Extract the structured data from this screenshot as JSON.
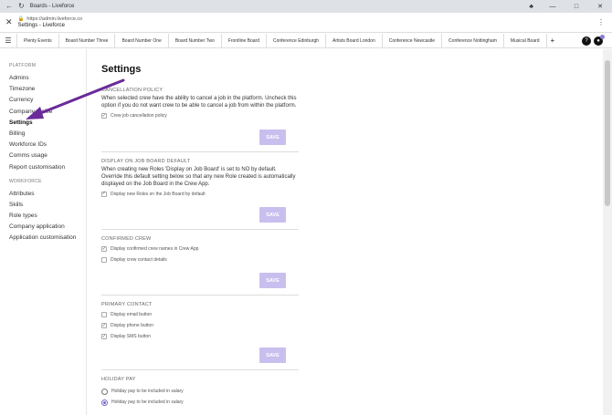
{
  "window": {
    "tab_title": "Boards - Liveforce",
    "url": "https://admin.liveforce.co",
    "page_title": "Settings - Liveforce"
  },
  "tabs": [
    "Plenty Events",
    "Board Number Three",
    "Board Number One",
    "Board Number Two",
    "Frontline Board",
    "Conference Edinburgh",
    "Artists Board London",
    "Conference Newcastle",
    "Conference Nottingham",
    "Musical Board"
  ],
  "sidebar": {
    "platform_heading": "PLATFORM",
    "platform_items": [
      "Admins",
      "Timezone",
      "Currency",
      "Company profile",
      "Settings",
      "Billing",
      "Workforce IDs",
      "Comms usage",
      "Report customisation"
    ],
    "workforce_heading": "WORKFORCE",
    "workforce_items": [
      "Attributes",
      "Skills",
      "Role types",
      "Company application",
      "Application customisation"
    ]
  },
  "main": {
    "heading": "Settings",
    "save_label": "SAVE",
    "cancellation": {
      "title": "CANCELLATION POLICY",
      "description": "When selected crew have the ability to cancel a job in the platform. Uncheck this option if you do not want crew to be able to cancel a job from within the platform.",
      "option": "Crew job cancellation policy"
    },
    "display_default": {
      "title": "DISPLAY ON JOB BOARD DEFAULT",
      "description": "When creating new Roles 'Display on Job Board' is set to NO by default. Override this default setting below so that any new Role created is automatically displayed on the Job Board in the Crew App.",
      "option": "Display new Roles on the Job Board by default"
    },
    "confirmed_crew": {
      "title": "CONFIRMED CREW",
      "options": [
        "Display confirmed crew names in Crew App",
        "Display crew contact details"
      ]
    },
    "primary_contact": {
      "title": "PRIMARY CONTACT",
      "options": [
        "Display email button",
        "Display phone button",
        "Display SMS button"
      ]
    },
    "holiday_pay": {
      "title": "HOLIDAY PAY",
      "options": [
        "Holiday pay to be included in salary",
        "Holiday pay to be included in salary"
      ]
    }
  },
  "colors": {
    "accent": "#7b68c8",
    "save_button": "#c9bfee",
    "arrow": "#6a2a9a"
  }
}
